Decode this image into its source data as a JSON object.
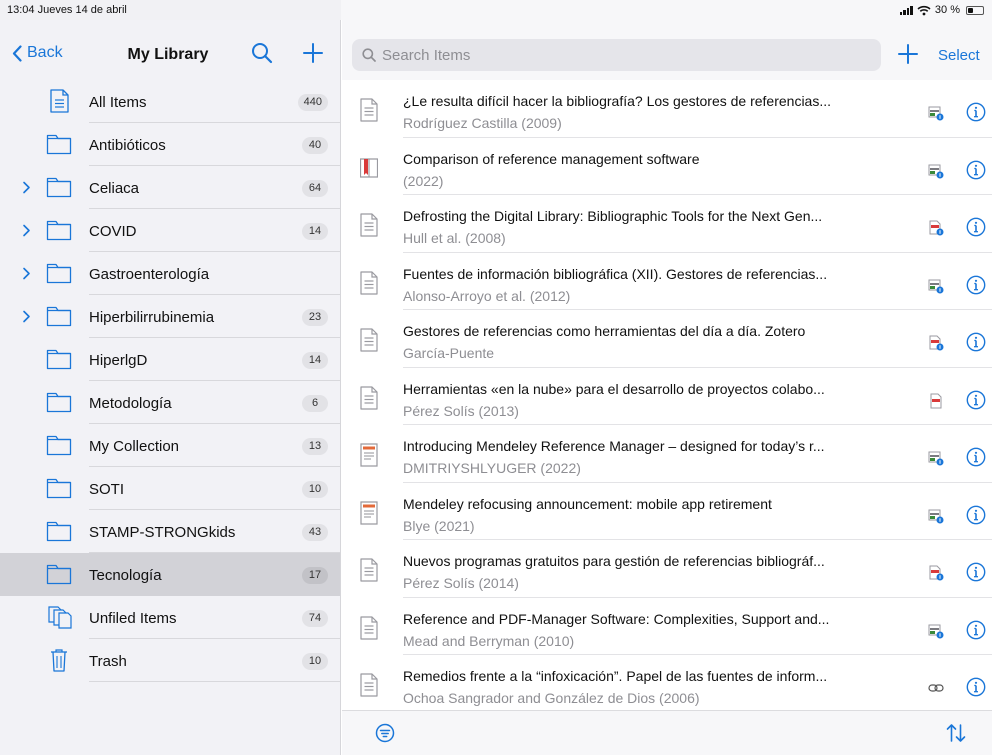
{
  "status": {
    "time_date": "13:04  Jueves 14 de abril",
    "battery": "30 %"
  },
  "sidebar": {
    "back_label": "Back",
    "title": "My Library",
    "collections": [
      {
        "label": "All Items",
        "count": "440",
        "icon": "document-icon",
        "expandable": false
      },
      {
        "label": "Antibióticos",
        "count": "40",
        "icon": "folder-icon",
        "expandable": false
      },
      {
        "label": "Celiaca",
        "count": "64",
        "icon": "folder-icon",
        "expandable": true
      },
      {
        "label": "COVID",
        "count": "14",
        "icon": "folder-icon",
        "expandable": true
      },
      {
        "label": "Gastroenterología",
        "count": "",
        "icon": "folder-icon",
        "expandable": true
      },
      {
        "label": "Hiperbilirrubinemia",
        "count": "23",
        "icon": "folder-icon",
        "expandable": true
      },
      {
        "label": "HiperlgD",
        "count": "14",
        "icon": "folder-icon",
        "expandable": false
      },
      {
        "label": "Metodología",
        "count": "6",
        "icon": "folder-icon",
        "expandable": false
      },
      {
        "label": "My Collection",
        "count": "13",
        "icon": "folder-icon",
        "expandable": false
      },
      {
        "label": "SOTI",
        "count": "10",
        "icon": "folder-icon",
        "expandable": false
      },
      {
        "label": "STAMP-STRONGkids",
        "count": "43",
        "icon": "folder-icon",
        "expandable": false
      },
      {
        "label": "Tecnología",
        "count": "17",
        "icon": "folder-icon",
        "expandable": false,
        "selected": true
      },
      {
        "label": "Unfiled Items",
        "count": "74",
        "icon": "unfiled-icon",
        "expandable": false
      },
      {
        "label": "Trash",
        "count": "10",
        "icon": "trash-icon",
        "expandable": false
      }
    ]
  },
  "main": {
    "search_placeholder": "Search Items",
    "select_label": "Select",
    "items": [
      {
        "title": "¿Le resulta difícil hacer la bibliografía? Los gestores de referencias...",
        "subtitle": "Rodríguez Castilla (2009)",
        "type_icon": "journal-article-icon",
        "attachment": "webpage-attachment-icon"
      },
      {
        "title": "Comparison of reference management software",
        "subtitle": "(2022)",
        "type_icon": "encyclopedia-article-icon",
        "attachment": "webpage-attachment-icon"
      },
      {
        "title": "Defrosting the Digital Library: Bibliographic Tools for the Next Gen...",
        "subtitle": "Hull et al. (2008)",
        "type_icon": "journal-article-icon",
        "attachment": "pdf-attachment-icon"
      },
      {
        "title": "Fuentes de información bibliográfica (XII). Gestores de referencias...",
        "subtitle": "Alonso-Arroyo et al. (2012)",
        "type_icon": "journal-article-icon",
        "attachment": "webpage-attachment-icon"
      },
      {
        "title": "Gestores de referencias como herramientas del día a día. Zotero",
        "subtitle": "García-Puente",
        "type_icon": "journal-article-icon",
        "attachment": "pdf-attachment-icon"
      },
      {
        "title": "Herramientas «en la nube» para el desarrollo de proyectos colabo...",
        "subtitle": "Pérez Solís (2013)",
        "type_icon": "journal-article-icon",
        "attachment": "pdf-file-icon"
      },
      {
        "title": "Introducing Mendeley Reference Manager – designed for today’s r...",
        "subtitle": "DMITRIYSHLYUGER (2022)",
        "type_icon": "blog-post-icon",
        "attachment": "webpage-attachment-icon"
      },
      {
        "title": "Mendeley refocusing announcement: mobile app retirement",
        "subtitle": "Blye (2021)",
        "type_icon": "blog-post-icon",
        "attachment": "webpage-attachment-icon"
      },
      {
        "title": "Nuevos programas gratuitos para gestión de referencias bibliográf...",
        "subtitle": "Pérez Solís (2014)",
        "type_icon": "journal-article-icon",
        "attachment": "pdf-attachment-icon"
      },
      {
        "title": "Reference and PDF-Manager Software: Complexities, Support and...",
        "subtitle": "Mead and Berryman (2010)",
        "type_icon": "journal-article-icon",
        "attachment": "webpage-attachment-icon"
      },
      {
        "title": "Remedios frente a la “infoxicación”. Papel de las fuentes de inform...",
        "subtitle": "Ochoa Sangrador and González de Dios (2006)",
        "type_icon": "journal-article-icon",
        "attachment": "link-icon"
      }
    ]
  },
  "colors": {
    "accent": "#1a76d8",
    "sidebar_bg": "#f2f2f6",
    "selected_row": "#d2d2d7",
    "secondary_text": "#8e8e93"
  }
}
